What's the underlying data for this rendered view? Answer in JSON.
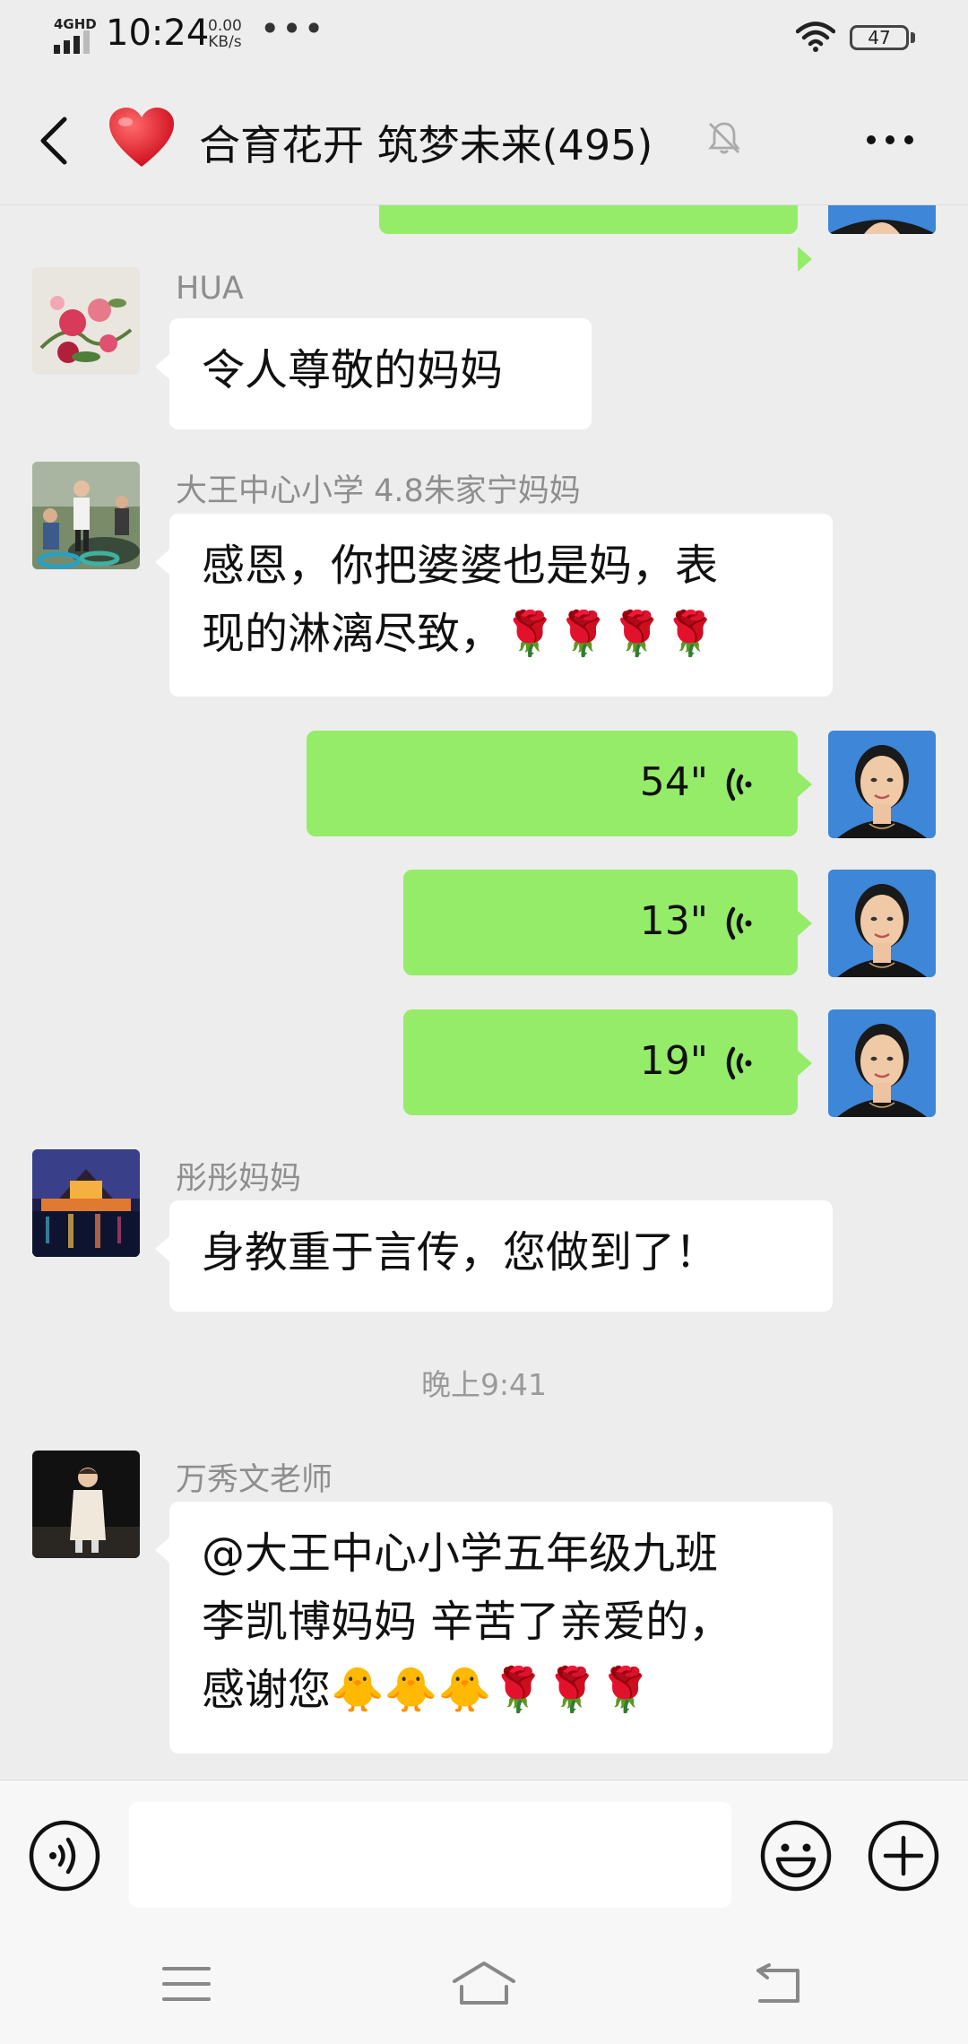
{
  "status_bar": {
    "network": "4GHD",
    "time": "10:24",
    "speed_value": "0.00",
    "speed_unit": "KB/s",
    "more": "•••",
    "battery": "47"
  },
  "header": {
    "title": "合育花开 筑梦未来(495)",
    "icons": [
      "back-icon",
      "heart-icon",
      "mute-bell-icon",
      "more-icon"
    ]
  },
  "chat": {
    "messages": [
      {
        "type": "text",
        "direction": "in",
        "sender": "HUA",
        "text": "令人尊敬的妈妈"
      },
      {
        "type": "text",
        "direction": "in",
        "sender": "大王中心小学 4.8朱家宁妈妈",
        "lines": [
          "感恩，你把婆婆也是妈，表",
          "现的淋漓尽致，🌹🌹🌹🌹"
        ]
      },
      {
        "type": "voice",
        "direction": "out",
        "duration": "54\""
      },
      {
        "type": "voice",
        "direction": "out",
        "duration": "13\""
      },
      {
        "type": "voice",
        "direction": "out",
        "duration": "19\""
      },
      {
        "type": "text",
        "direction": "in",
        "sender": "彤彤妈妈",
        "text": "身教重于言传，您做到了！"
      },
      {
        "type": "time",
        "text": "晚上9:41"
      },
      {
        "type": "text",
        "direction": "in",
        "sender": "万秀文老师",
        "lines": [
          "@大王中心小学五年级九班",
          "李凯博妈妈  辛苦了亲爱的，",
          "感谢您🐥🐥🐥🌹🌹🌹"
        ]
      }
    ]
  },
  "input_bar": {
    "value": "",
    "icons": [
      "voice-toggle-icon",
      "emoji-icon",
      "plus-icon"
    ]
  },
  "nav_bar": {
    "icons": [
      "menu-icon",
      "home-icon",
      "back-nav-icon"
    ]
  },
  "colors": {
    "background": "#ededed",
    "bubble_out": "#95ec69",
    "bubble_in": "#ffffff",
    "avatar_self_bg": "#3d86d8"
  }
}
